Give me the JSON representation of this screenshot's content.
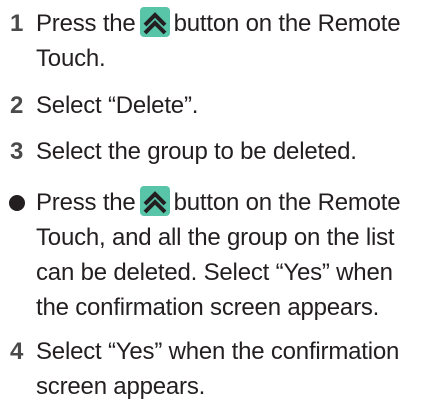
{
  "steps": [
    {
      "number": "1",
      "pre": "Press the",
      "post": "button on the Remote",
      "line2": "Touch."
    },
    {
      "number": "2",
      "text": "Select “Delete”."
    },
    {
      "number": "3",
      "text": "Select the group to be deleted."
    }
  ],
  "note": {
    "pre": "Press the",
    "post": "button on the Remote",
    "line2": "Touch, and all the group on the list",
    "line3": "can be deleted. Select “Yes” when",
    "line4": "the confirmation screen appears."
  },
  "step4": {
    "number": "4",
    "line1": "Select “Yes” when the confirmation",
    "line2": "screen appears."
  },
  "icons": {
    "remote_button": "double-chevron-up-icon"
  },
  "colors": {
    "text": "#231f20",
    "number": "#4a4a4a",
    "icon_bg": "#58c4a8",
    "icon_fg": "#231f20"
  }
}
